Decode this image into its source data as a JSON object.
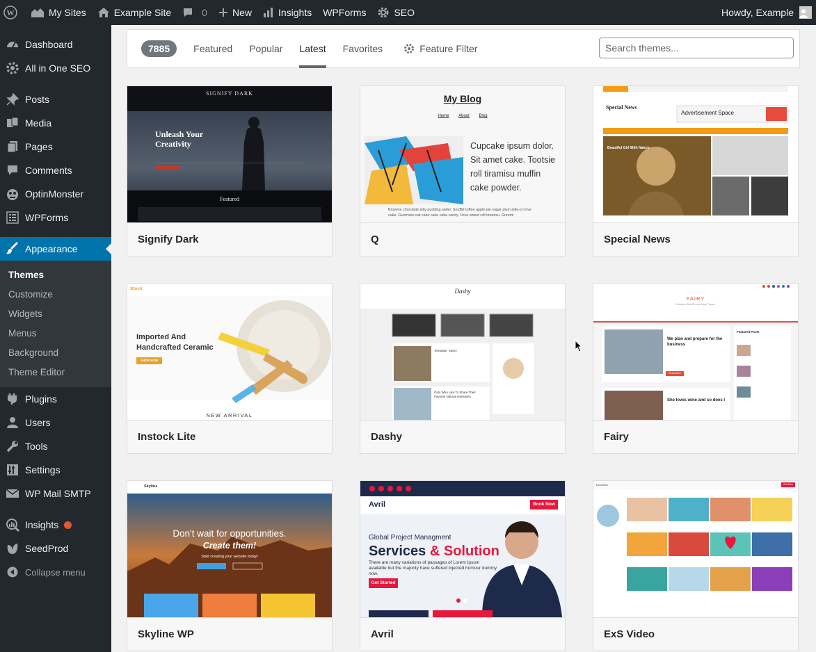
{
  "adminbar": {
    "wp_logo": "wordpress-logo",
    "my_sites": "My Sites",
    "site_name": "Example Site",
    "comments_count": "0",
    "new_label": "New",
    "insights": "Insights",
    "wpforms": "WPForms",
    "seo": "SEO",
    "howdy": "Howdy, Example"
  },
  "sidebar": {
    "items": [
      {
        "label": "Dashboard",
        "icon": "dashboard-icon"
      },
      {
        "label": "All in One SEO",
        "icon": "seo-gear-icon"
      },
      {
        "label": "Posts",
        "icon": "pin-icon"
      },
      {
        "label": "Media",
        "icon": "media-icon"
      },
      {
        "label": "Pages",
        "icon": "pages-icon"
      },
      {
        "label": "Comments",
        "icon": "comment-icon"
      },
      {
        "label": "OptinMonster",
        "icon": "optinmonster-icon"
      },
      {
        "label": "WPForms",
        "icon": "forms-icon"
      },
      {
        "label": "Appearance",
        "icon": "brush-icon"
      },
      {
        "label": "Plugins",
        "icon": "plugin-icon"
      },
      {
        "label": "Users",
        "icon": "user-icon"
      },
      {
        "label": "Tools",
        "icon": "wrench-icon"
      },
      {
        "label": "Settings",
        "icon": "settings-icon"
      },
      {
        "label": "WP Mail SMTP",
        "icon": "mail-icon"
      },
      {
        "label": "Insights",
        "icon": "insights-icon"
      },
      {
        "label": "SeedProd",
        "icon": "seedprod-icon"
      },
      {
        "label": "Collapse menu",
        "icon": "collapse-icon"
      }
    ],
    "submenu": [
      "Themes",
      "Customize",
      "Widgets",
      "Menus",
      "Background",
      "Theme Editor"
    ],
    "accent": "#0073aa"
  },
  "filterbar": {
    "count": "7885",
    "tabs": [
      "Featured",
      "Popular",
      "Latest",
      "Favorites"
    ],
    "current_tab": "Latest",
    "feature_filter": "Feature Filter",
    "search_placeholder": "Search themes..."
  },
  "themes": [
    {
      "name": "Signify Dark",
      "preview": {
        "site_title": "SIGNIFY DARK",
        "heading": "Unleash Your Creativity",
        "featured": "Featured"
      }
    },
    {
      "name": "Q",
      "preview": {
        "blog_title": "My Blog",
        "nav": [
          "Home",
          "About",
          "Blog"
        ],
        "lead": "Cupcake ipsum dolor. Sit amet cake. Tootsie roll tiramisu muffin cake powder.",
        "body": "Brownie chocolate jelly pudding wafer. Soufflé toffee apple pie sugar plum jelly-o I love cake. Gummies oat cake cake cake candy I love sweet roll tiramisu. Gummi"
      }
    },
    {
      "name": "Special News",
      "preview": {
        "title": "Special News",
        "ad": "Advertisement Space",
        "headline": "Beautiful Girl With Nature"
      }
    },
    {
      "name": "Instock Lite",
      "preview": {
        "logo": "Stock",
        "heading": "Imported And Handcrafted Ceramic",
        "button": "SHOP NOW",
        "footer": "NEW ARRIVAL"
      }
    },
    {
      "name": "Dashy",
      "preview": {
        "logo": "Dashy",
        "post1": "Template: Sticky",
        "post2": "Girls Who Like To Share Their Favorite Natural Hairstyles"
      }
    },
    {
      "name": "Fairy",
      "preview": {
        "logo": "FAIRY",
        "tagline": "Minimal WordPress Blog Theme",
        "post1": "We plan and prepare for the business",
        "post2": "She loves wine and so does I",
        "sidebar_title": "Featured Posts",
        "button": "Read More"
      }
    },
    {
      "name": "Skyline WP",
      "preview": {
        "logo": "Skyline",
        "line1": "Don't wait for opportunities.",
        "line2": "Create them!",
        "sub": "Start creating your website today!"
      }
    },
    {
      "name": "Avril",
      "preview": {
        "logo": "Avril",
        "kicker": "Global Project Managment",
        "headline_a": "Services",
        "headline_b": "& Solution",
        "body": "There are many variations of passages of Lorem Ipsum available but the majority have suffered injected humour dummy now.",
        "button": "Get Started",
        "cta": "Book Now"
      }
    },
    {
      "name": "ExS Video",
      "preview": {
        "logo": "ExsVideo",
        "cta": "Get Free"
      }
    }
  ]
}
